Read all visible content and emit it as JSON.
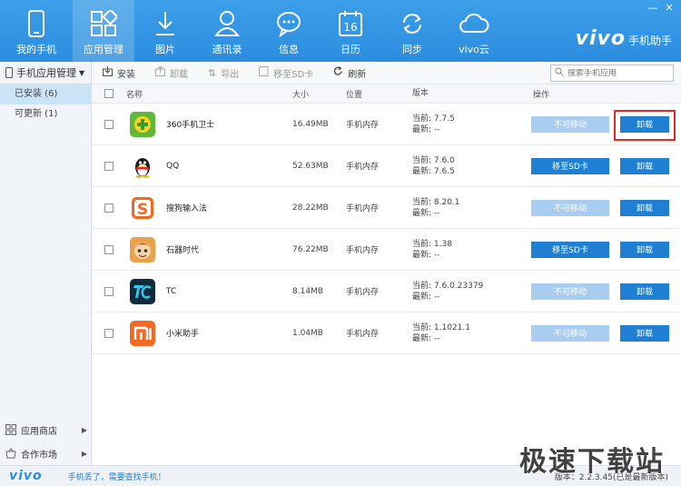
{
  "nav": [
    {
      "label": "我的手机",
      "icon": "phone-icon"
    },
    {
      "label": "应用管理",
      "icon": "apps-icon",
      "active": true
    },
    {
      "label": "图片",
      "icon": "download-image-icon"
    },
    {
      "label": "通讯录",
      "icon": "contact-icon"
    },
    {
      "label": "信息",
      "icon": "message-icon"
    },
    {
      "label": "日历",
      "icon": "calendar-icon",
      "badge": "16"
    },
    {
      "label": "同步",
      "icon": "sync-icon"
    },
    {
      "label": "vivo云",
      "icon": "cloud-icon"
    }
  ],
  "brand": {
    "logo": "vivo",
    "sub": "手机助手"
  },
  "window_controls": [
    "—",
    "✕"
  ],
  "sidebar": {
    "header": "手机应用管理",
    "items": [
      {
        "label": "已安装 (6)",
        "active": true
      },
      {
        "label": "可更新 (1)",
        "active": false
      }
    ],
    "bottom": [
      {
        "label": "应用商店",
        "icon": "grid-icon"
      },
      {
        "label": "合作市场",
        "icon": "basket-icon"
      }
    ]
  },
  "toolbar": {
    "install": "安装",
    "uninstall": "卸载",
    "export": "导出",
    "move_sd": "移至SD卡",
    "refresh": "刷新",
    "search_placeholder": "搜索手机应用"
  },
  "table": {
    "headers": {
      "name": "名称",
      "size": "大小",
      "location": "位置",
      "version": "版本",
      "ops": "操作"
    },
    "rows": [
      {
        "name": "360手机卫士",
        "size": "16.49MB",
        "location": "手机内存",
        "current": "当前: 7.7.5",
        "latest": "最新: --",
        "move": "不可移动",
        "move_enabled": false,
        "uninstall": "卸载",
        "highlight": true,
        "icon": "security-360-icon",
        "icon_bg": "#5fb83a"
      },
      {
        "name": "QQ",
        "size": "52.63MB",
        "location": "手机内存",
        "current": "当前: 7.6.0",
        "latest": "最新: 7.6.5",
        "move": "移至SD卡",
        "move_enabled": true,
        "uninstall": "卸载",
        "highlight": false,
        "icon": "qq-penguin-icon",
        "icon_bg": "#ffffff"
      },
      {
        "name": "搜狗输入法",
        "size": "28.22MB",
        "location": "手机内存",
        "current": "当前: 8.20.1",
        "latest": "最新: --",
        "move": "不可移动",
        "move_enabled": false,
        "uninstall": "卸载",
        "highlight": false,
        "icon": "sogou-icon",
        "icon_bg": "#f16a21"
      },
      {
        "name": "石器时代",
        "size": "76.22MB",
        "location": "手机内存",
        "current": "当前: 1.38",
        "latest": "最新: --",
        "move": "移至SD卡",
        "move_enabled": true,
        "uninstall": "卸载",
        "highlight": false,
        "icon": "stone-age-icon",
        "icon_bg": "#e9a24a"
      },
      {
        "name": "TC",
        "size": "8.14MB",
        "location": "手机内存",
        "current": "当前: 7.6.0.23379",
        "latest": "最新: --",
        "move": "不可移动",
        "move_enabled": false,
        "uninstall": "卸载",
        "highlight": false,
        "icon": "tc-icon",
        "icon_bg": "#0d2b3a"
      },
      {
        "name": "小米助手",
        "size": "1.04MB",
        "location": "手机内存",
        "current": "当前: 1.1021.1",
        "latest": "最新: --",
        "move": "不可移动",
        "move_enabled": false,
        "uninstall": "卸载",
        "highlight": false,
        "icon": "mi-icon",
        "icon_bg": "#f26b22"
      }
    ]
  },
  "status": {
    "logo": "vivo",
    "link": "手机丢了，需要查找手机！",
    "version": "版本：2.2.3.45(已是最新版本)"
  },
  "watermark": "极速下载站"
}
